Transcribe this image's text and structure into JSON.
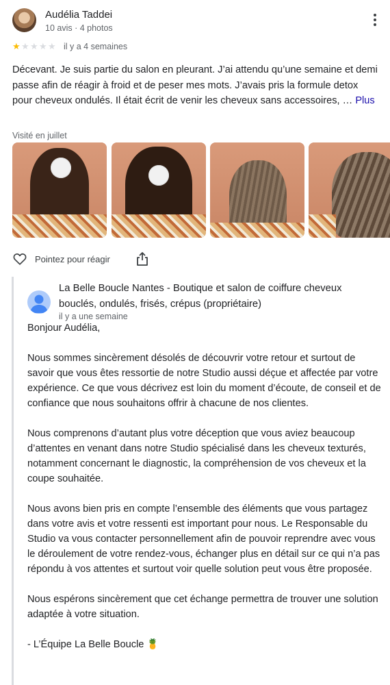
{
  "review": {
    "author": "Audélia Taddei",
    "meta": "10 avis · 4 photos",
    "rating": 1,
    "rating_max": 5,
    "date": "il y a 4 semaines",
    "text": "Décevant. Je suis partie du salon en pleurant. J’ai attendu qu’une semaine et demi passe afin de réagir à froid et de peser mes mots. J’avais pris la formule detox pour cheveux ondulés. Il était écrit de venir les cheveux sans accessoires, …",
    "more_label": "Plus",
    "visited": "Visité en juillet",
    "photos": [
      "photo-1",
      "photo-2",
      "photo-3",
      "photo-4"
    ],
    "react_label": "Pointez pour réagir",
    "colors": {
      "star_filled": "#fbbc04",
      "star_empty": "#dadce0",
      "link": "#1a0dab"
    }
  },
  "owner": {
    "name": "La Belle Boucle Nantes - Boutique et salon de coiffure cheveux bouclés, ondulés, frisés, crépus (propriétaire)",
    "date": "il y a une semaine",
    "paragraphs": [
      "Bonjour Audélia,",
      "Nous sommes sincèrement désolés de découvrir votre retour et surtout de savoir que vous êtes ressortie de notre Studio aussi déçue et affectée par votre expérience. Ce que vous décrivez est loin du moment d’écoute, de conseil et de confiance que nous souhaitons offrir à chacune de nos clientes.",
      "Nous comprenons d’autant plus votre déception que vous aviez beaucoup d’attentes en venant dans notre Studio spécialisé dans les cheveux texturés, notamment concernant le diagnostic, la compréhension de vos cheveux et la coupe souhaitée.",
      "Nous avons bien pris en compte l’ensemble des éléments que vous partagez dans votre avis et votre ressenti est important pour nous. Le Responsable du Studio va vous contacter personnellement afin de pouvoir reprendre avec vous le déroulement de votre rendez-vous, échanger plus en détail sur ce qui n’a pas répondu à vos attentes et surtout voir quelle solution peut vous être proposée.",
      "Nous espérons sincèrement que cet échange permettra de trouver une solution adaptée à votre situation.",
      "- L’Équipe La Belle Boucle 🍍"
    ]
  }
}
